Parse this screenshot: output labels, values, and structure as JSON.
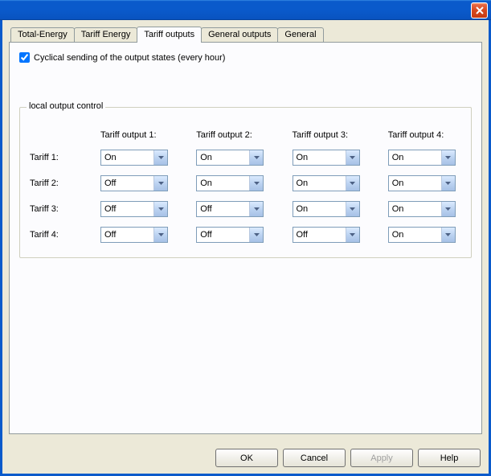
{
  "window": {
    "close_icon": "close-icon"
  },
  "tabs": [
    {
      "label": "Total-Energy"
    },
    {
      "label": "Tariff Energy"
    },
    {
      "label": "Tariff outputs",
      "active": true
    },
    {
      "label": "General outputs"
    },
    {
      "label": "General"
    }
  ],
  "checkbox": {
    "label": "Cyclical sending of the output states (every hour)",
    "checked": true
  },
  "group": {
    "title": "local output control",
    "columns": [
      "Tariff output 1:",
      "Tariff output 2:",
      "Tariff output 3:",
      "Tariff output 4:"
    ],
    "rows": [
      "Tariff 1:",
      "Tariff 2:",
      "Tariff 3:",
      "Tariff 4:"
    ],
    "values": [
      [
        "On",
        "On",
        "On",
        "On"
      ],
      [
        "Off",
        "On",
        "On",
        "On"
      ],
      [
        "Off",
        "Off",
        "On",
        "On"
      ],
      [
        "Off",
        "Off",
        "Off",
        "On"
      ]
    ]
  },
  "buttons": {
    "ok": "OK",
    "cancel": "Cancel",
    "apply": "Apply",
    "help": "Help"
  }
}
